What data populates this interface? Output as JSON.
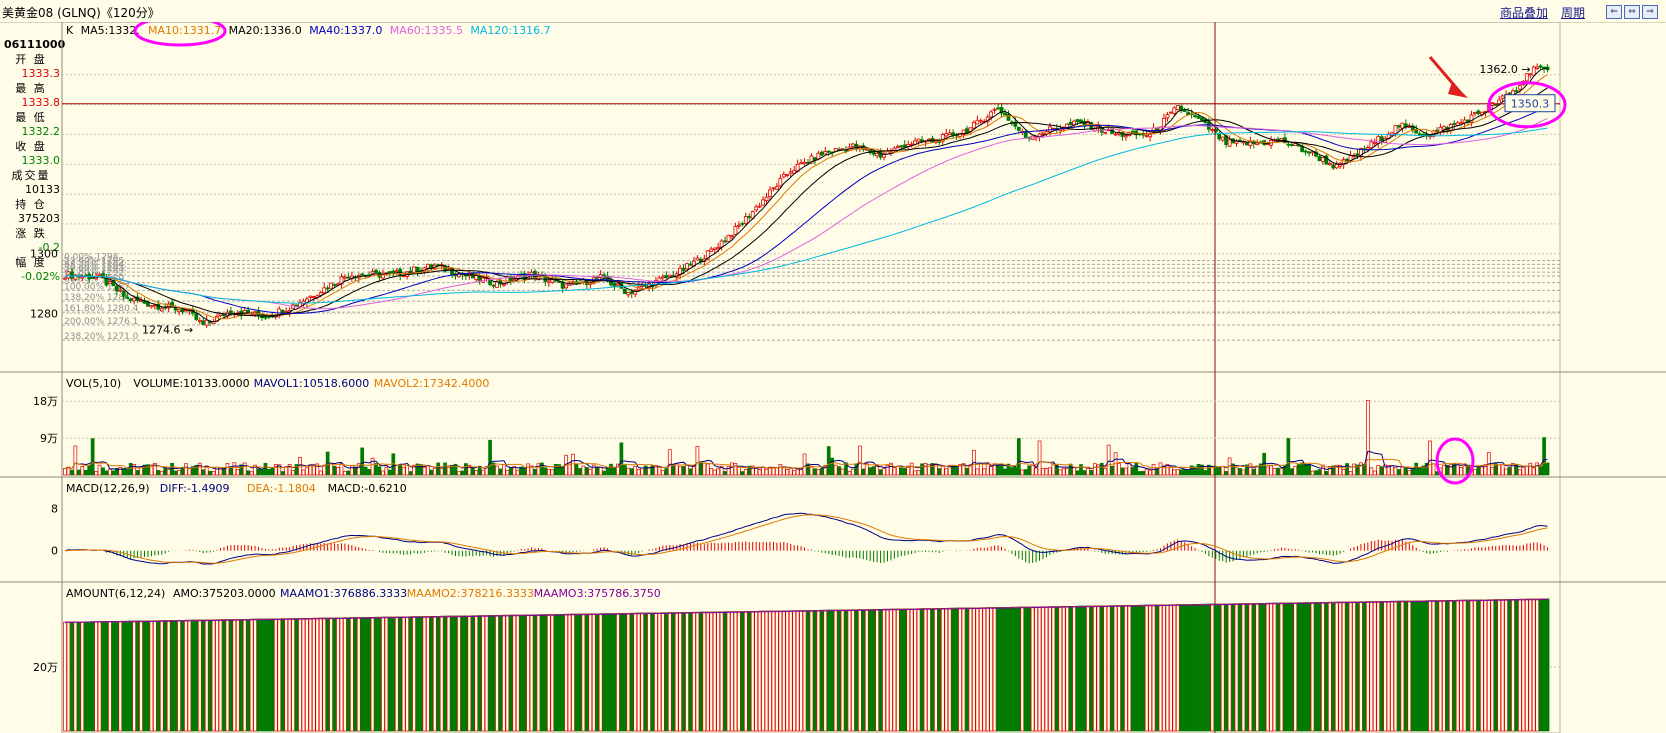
{
  "header": {
    "title": "美黄金08 (GLNQ)《120分》",
    "btn_overlay": "商品叠加",
    "btn_period": "周期",
    "win_buttons": [
      "⇐",
      "⇔",
      "⇒"
    ]
  },
  "info_panel": {
    "code": "06111000",
    "items": [
      {
        "label": "开 盘",
        "value": "1333.3",
        "color": "#e00000"
      },
      {
        "label": "最 高",
        "value": "1333.8",
        "color": "#e00000"
      },
      {
        "label": "最 低",
        "value": "1332.2",
        "color": "#008000"
      },
      {
        "label": "收 盘",
        "value": "1333.0",
        "color": "#008000"
      },
      {
        "label": "成交量",
        "value": "10133",
        "color": "#000000"
      },
      {
        "label": "持 仓",
        "value": "375203",
        "color": "#000000"
      },
      {
        "label": "涨 跌",
        "value": "-0.2",
        "color": "#008000"
      },
      {
        "label": "幅 度",
        "value": "-0.02%",
        "color": "#008000"
      }
    ]
  },
  "chart_data": [
    {
      "type": "candlestick",
      "id": "price",
      "legend": [
        {
          "text": "K",
          "color": "#000000"
        },
        {
          "text": "MA5:1332.",
          "color": "#000000"
        },
        {
          "text": "MA10:1331.7",
          "color": "#e07800"
        },
        {
          "text": "MA20:1336.0",
          "color": "#000000"
        },
        {
          "text": "MA40:1337.0",
          "color": "#0000c0"
        },
        {
          "text": "MA60:1335.5",
          "color": "#e060e0"
        },
        {
          "text": "MA120:1316.7",
          "color": "#00b8e0"
        }
      ],
      "ylim": [
        1262,
        1371
      ],
      "yticks": [
        1280,
        1300
      ],
      "current_price_label": "1350.3",
      "current_price": 1350.3,
      "annotations": [
        {
          "text": "1362.0",
          "value": 1362.0,
          "index": -3
        },
        {
          "text": "1274.6",
          "value": 1274.6,
          "index": 40
        }
      ],
      "fib_levels": [
        {
          "text": "0.00% 1298.",
          "value": 1297.7
        },
        {
          "text": "23.60% 1295.",
          "value": 1296.4
        },
        {
          "text": "38.20% 1294.",
          "value": 1295.1
        },
        {
          "text": "50.00% 1293.",
          "value": 1293.8
        },
        {
          "text": "61.80% 1292.",
          "value": 1292.5
        },
        {
          "text": "80.90% 1289.",
          "value": 1290.3
        },
        {
          "text": "100.00% 1287.",
          "value": 1287.7
        },
        {
          "text": "138.20% 1284.",
          "value": 1284.1
        },
        {
          "text": "161.80% 1280.4",
          "value": 1280.4
        },
        {
          "text": "200.00% 1276.1",
          "value": 1276.1
        },
        {
          "text": "238.20% 1271.0",
          "value": 1271.0
        }
      ],
      "close_anchors": [
        [
          0,
          1293
        ],
        [
          10,
          1292
        ],
        [
          18,
          1285
        ],
        [
          25,
          1283
        ],
        [
          35,
          1281
        ],
        [
          40,
          1276
        ],
        [
          48,
          1281
        ],
        [
          58,
          1279
        ],
        [
          65,
          1282
        ],
        [
          73,
          1287
        ],
        [
          82,
          1293
        ],
        [
          95,
          1293
        ],
        [
          107,
          1296
        ],
        [
          115,
          1293
        ],
        [
          125,
          1290
        ],
        [
          135,
          1293
        ],
        [
          145,
          1289
        ],
        [
          155,
          1292
        ],
        [
          163,
          1287
        ],
        [
          170,
          1290
        ],
        [
          178,
          1294
        ],
        [
          186,
          1300
        ],
        [
          194,
          1308
        ],
        [
          202,
          1318
        ],
        [
          210,
          1328
        ],
        [
          220,
          1334
        ],
        [
          228,
          1336
        ],
        [
          236,
          1333
        ],
        [
          244,
          1337
        ],
        [
          252,
          1338
        ],
        [
          262,
          1342
        ],
        [
          270,
          1349
        ],
        [
          278,
          1339
        ],
        [
          286,
          1342
        ],
        [
          294,
          1344
        ],
        [
          304,
          1340
        ],
        [
          314,
          1340
        ],
        [
          322,
          1349
        ],
        [
          328,
          1345
        ],
        [
          336,
          1337
        ],
        [
          344,
          1337
        ],
        [
          352,
          1338
        ],
        [
          360,
          1334
        ],
        [
          368,
          1329
        ],
        [
          376,
          1335
        ],
        [
          386,
          1343
        ],
        [
          394,
          1340
        ],
        [
          404,
          1344
        ],
        [
          412,
          1349
        ],
        [
          420,
          1355
        ],
        [
          425,
          1363
        ],
        [
          428,
          1361
        ]
      ],
      "hl_line": 1350.3
    },
    {
      "type": "bar",
      "id": "volume",
      "legend": [
        {
          "text": "VOL(5,10)",
          "color": "#000000"
        },
        {
          "text": "VOLUME:10133.0000",
          "color": "#000000"
        },
        {
          "text": "MAVOL1:10518.6000",
          "color": "#000080"
        },
        {
          "text": "MAVOL2:17342.4000",
          "color": "#e07800"
        }
      ],
      "ylim": [
        0,
        200000
      ],
      "yticks": [
        {
          "text": "9万",
          "value": 90000
        },
        {
          "text": "18万",
          "value": 180000
        }
      ]
    },
    {
      "type": "line",
      "id": "macd",
      "legend": [
        {
          "text": "MACD(12,26,9)",
          "color": "#000000"
        },
        {
          "text": "DIFF:-1.4909",
          "color": "#000080"
        },
        {
          "text": "DEA:-1.1804",
          "color": "#e07800"
        },
        {
          "text": "MACD:-0.6210",
          "color": "#000000"
        }
      ],
      "ylim": [
        -5,
        10
      ],
      "yticks": [
        {
          "text": "0",
          "value": 0
        },
        {
          "text": "8",
          "value": 8
        }
      ]
    },
    {
      "type": "bar",
      "id": "amount",
      "legend": [
        {
          "text": "AMOUNT(6,12,24)",
          "color": "#000000"
        },
        {
          "text": "AMO:375203.0000",
          "color": "#000000"
        },
        {
          "text": "MAAMO1:376886.3333",
          "color": "#000080"
        },
        {
          "text": "MAAMO2:378216.3333",
          "color": "#e07800"
        },
        {
          "text": "MAAMO3:375786.3750",
          "color": "#8000a0"
        }
      ],
      "ylim": [
        0,
        400000
      ],
      "yticks": [
        {
          "text": "20万",
          "value": 200000
        }
      ]
    }
  ]
}
